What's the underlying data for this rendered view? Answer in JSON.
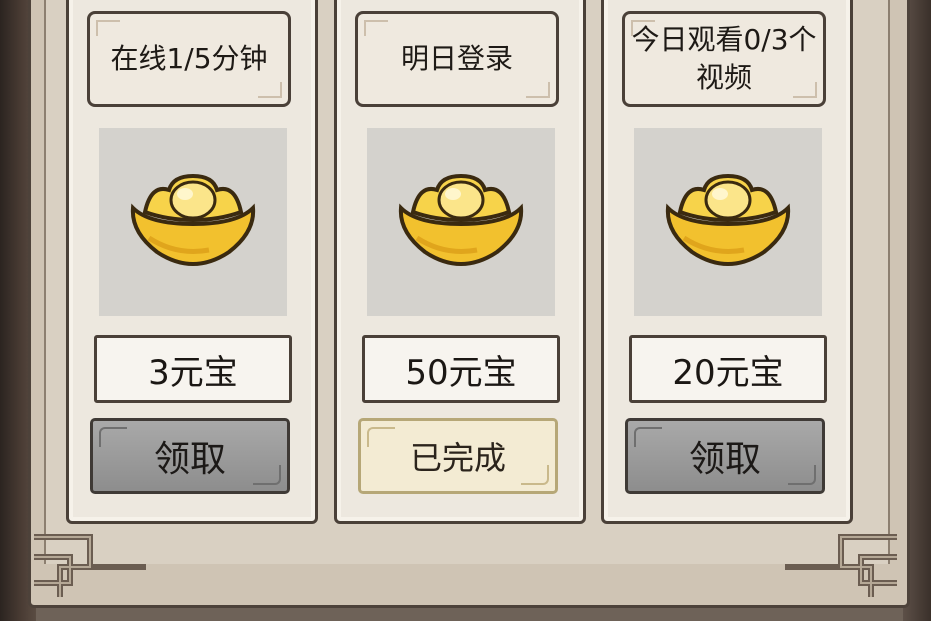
{
  "cards": [
    {
      "task": "在线1/5分钟",
      "reward": "3元宝",
      "button": "领取",
      "button_state": "claimable"
    },
    {
      "task": "明日登录",
      "reward": "50元宝",
      "button": "已完成",
      "button_state": "completed"
    },
    {
      "task": "今日观看0/3个视频",
      "reward": "20元宝",
      "button": "领取",
      "button_state": "claimable"
    }
  ],
  "reward_icon": "gold-ingot-icon",
  "colors": {
    "claim_button": "#9b9b9b",
    "completed_button": "#f3ebd3",
    "gold": "#f2c12e",
    "frame": "#4a4038"
  }
}
